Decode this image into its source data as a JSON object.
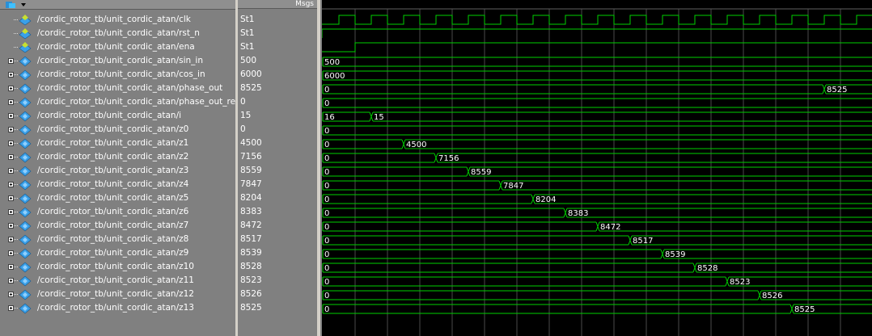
{
  "header": {
    "msgs_label": "Msgs"
  },
  "signals": [
    {
      "name": "/cordic_rotor_tb/unit_cordic_atan/clk",
      "value": "St1",
      "expandable": false,
      "kind": "bit"
    },
    {
      "name": "/cordic_rotor_tb/unit_cordic_atan/rst_n",
      "value": "St1",
      "expandable": false,
      "kind": "bit"
    },
    {
      "name": "/cordic_rotor_tb/unit_cordic_atan/ena",
      "value": "St1",
      "expandable": false,
      "kind": "bit"
    },
    {
      "name": "/cordic_rotor_tb/unit_cordic_atan/sin_in",
      "value": "500",
      "expandable": true,
      "kind": "bus"
    },
    {
      "name": "/cordic_rotor_tb/unit_cordic_atan/cos_in",
      "value": "6000",
      "expandable": true,
      "kind": "bus"
    },
    {
      "name": "/cordic_rotor_tb/unit_cordic_atan/phase_out",
      "value": "8525",
      "expandable": true,
      "kind": "bus"
    },
    {
      "name": "/cordic_rotor_tb/unit_cordic_atan/phase_out_reg",
      "value": "0",
      "expandable": true,
      "kind": "bus"
    },
    {
      "name": "/cordic_rotor_tb/unit_cordic_atan/i",
      "value": "15",
      "expandable": true,
      "kind": "bus"
    },
    {
      "name": "/cordic_rotor_tb/unit_cordic_atan/z0",
      "value": "0",
      "expandable": true,
      "kind": "bus"
    },
    {
      "name": "/cordic_rotor_tb/unit_cordic_atan/z1",
      "value": "4500",
      "expandable": true,
      "kind": "bus"
    },
    {
      "name": "/cordic_rotor_tb/unit_cordic_atan/z2",
      "value": "7156",
      "expandable": true,
      "kind": "bus"
    },
    {
      "name": "/cordic_rotor_tb/unit_cordic_atan/z3",
      "value": "8559",
      "expandable": true,
      "kind": "bus"
    },
    {
      "name": "/cordic_rotor_tb/unit_cordic_atan/z4",
      "value": "7847",
      "expandable": true,
      "kind": "bus"
    },
    {
      "name": "/cordic_rotor_tb/unit_cordic_atan/z5",
      "value": "8204",
      "expandable": true,
      "kind": "bus"
    },
    {
      "name": "/cordic_rotor_tb/unit_cordic_atan/z6",
      "value": "8383",
      "expandable": true,
      "kind": "bus"
    },
    {
      "name": "/cordic_rotor_tb/unit_cordic_atan/z7",
      "value": "8472",
      "expandable": true,
      "kind": "bus"
    },
    {
      "name": "/cordic_rotor_tb/unit_cordic_atan/z8",
      "value": "8517",
      "expandable": true,
      "kind": "bus"
    },
    {
      "name": "/cordic_rotor_tb/unit_cordic_atan/z9",
      "value": "8539",
      "expandable": true,
      "kind": "bus"
    },
    {
      "name": "/cordic_rotor_tb/unit_cordic_atan/z10",
      "value": "8528",
      "expandable": true,
      "kind": "bus"
    },
    {
      "name": "/cordic_rotor_tb/unit_cordic_atan/z11",
      "value": "8523",
      "expandable": true,
      "kind": "bus"
    },
    {
      "name": "/cordic_rotor_tb/unit_cordic_atan/z12",
      "value": "8526",
      "expandable": true,
      "kind": "bus"
    },
    {
      "name": "/cordic_rotor_tb/unit_cordic_atan/z13",
      "value": "8525",
      "expandable": true,
      "kind": "bus"
    }
  ],
  "waves": {
    "clk_period_cycles": 1,
    "bus_segments": [
      {
        "row": 3,
        "segments": [
          {
            "cycle": 0,
            "label": "500"
          }
        ]
      },
      {
        "row": 4,
        "segments": [
          {
            "cycle": 0,
            "label": "6000"
          }
        ]
      },
      {
        "row": 5,
        "segments": [
          {
            "cycle": 0,
            "label": "0"
          },
          {
            "cycle": 15.5,
            "label": "8525"
          }
        ]
      },
      {
        "row": 6,
        "segments": [
          {
            "cycle": 0,
            "label": "0"
          }
        ]
      },
      {
        "row": 7,
        "segments": [
          {
            "cycle": 0,
            "label": "16"
          },
          {
            "cycle": 1.5,
            "label": "15"
          }
        ]
      },
      {
        "row": 8,
        "segments": [
          {
            "cycle": 0,
            "label": "0"
          }
        ]
      },
      {
        "row": 9,
        "segments": [
          {
            "cycle": 0,
            "label": "0"
          },
          {
            "cycle": 2.5,
            "label": "4500"
          }
        ]
      },
      {
        "row": 10,
        "segments": [
          {
            "cycle": 0,
            "label": "0"
          },
          {
            "cycle": 3.5,
            "label": "7156"
          }
        ]
      },
      {
        "row": 11,
        "segments": [
          {
            "cycle": 0,
            "label": "0"
          },
          {
            "cycle": 4.5,
            "label": "8559"
          }
        ]
      },
      {
        "row": 12,
        "segments": [
          {
            "cycle": 0,
            "label": "0"
          },
          {
            "cycle": 5.5,
            "label": "7847"
          }
        ]
      },
      {
        "row": 13,
        "segments": [
          {
            "cycle": 0,
            "label": "0"
          },
          {
            "cycle": 6.5,
            "label": "8204"
          }
        ]
      },
      {
        "row": 14,
        "segments": [
          {
            "cycle": 0,
            "label": "0"
          },
          {
            "cycle": 7.5,
            "label": "8383"
          }
        ]
      },
      {
        "row": 15,
        "segments": [
          {
            "cycle": 0,
            "label": "0"
          },
          {
            "cycle": 8.5,
            "label": "8472"
          }
        ]
      },
      {
        "row": 16,
        "segments": [
          {
            "cycle": 0,
            "label": "0"
          },
          {
            "cycle": 9.5,
            "label": "8517"
          }
        ]
      },
      {
        "row": 17,
        "segments": [
          {
            "cycle": 0,
            "label": "0"
          },
          {
            "cycle": 10.5,
            "label": "8539"
          }
        ]
      },
      {
        "row": 18,
        "segments": [
          {
            "cycle": 0,
            "label": "0"
          },
          {
            "cycle": 11.5,
            "label": "8528"
          }
        ]
      },
      {
        "row": 19,
        "segments": [
          {
            "cycle": 0,
            "label": "0"
          },
          {
            "cycle": 12.5,
            "label": "8523"
          }
        ]
      },
      {
        "row": 20,
        "segments": [
          {
            "cycle": 0,
            "label": "0"
          },
          {
            "cycle": 13.5,
            "label": "8526"
          }
        ]
      },
      {
        "row": 21,
        "segments": [
          {
            "cycle": 0,
            "label": "0"
          },
          {
            "cycle": 14.5,
            "label": "8525"
          }
        ]
      }
    ]
  },
  "colors": {
    "wave": "#00d000",
    "grid": "#4a4a4a",
    "pane": "#808080",
    "text": "#ffffff",
    "splitter": "#d4d0c8"
  }
}
